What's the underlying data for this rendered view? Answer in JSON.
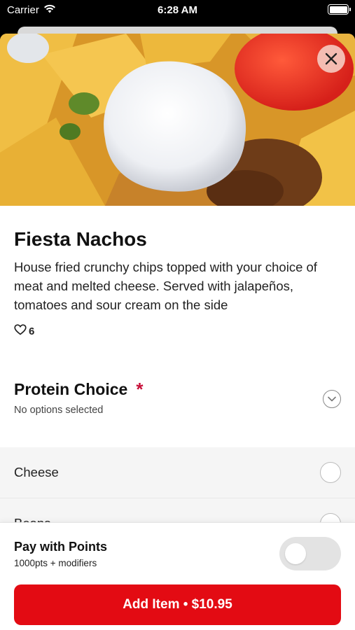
{
  "status_bar": {
    "carrier": "Carrier",
    "time": "6:28 AM"
  },
  "item": {
    "title": "Fiesta Nachos",
    "description": "House fried crunchy chips topped with your choice of meat and melted cheese. Served with jalapeños, tomatoes and sour cream on the side",
    "likes": "6"
  },
  "protein": {
    "title": "Protein Choice",
    "required_marker": "*",
    "subtitle": "No options selected",
    "options": [
      "Cheese",
      "Beans"
    ]
  },
  "points": {
    "title": "Pay with Points",
    "subtitle": "1000pts + modifiers",
    "enabled": false
  },
  "add_button": {
    "label": "Add Item • $10.95"
  },
  "colors": {
    "accent": "#e30b13",
    "required": "#c8103a"
  },
  "icons": [
    "wifi-icon",
    "battery-icon",
    "close-icon",
    "heart-icon",
    "chevron-down-icon"
  ]
}
